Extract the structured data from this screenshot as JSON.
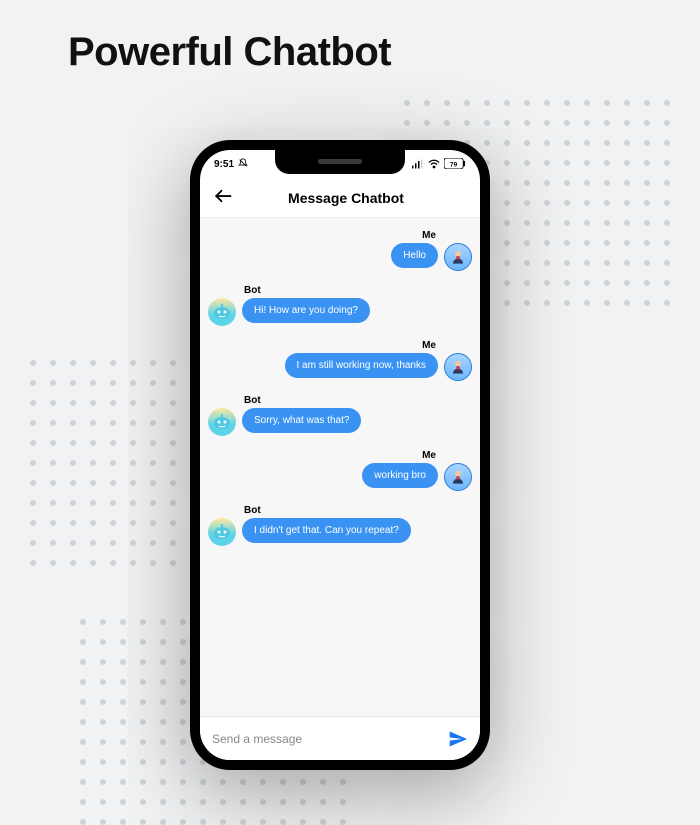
{
  "page": {
    "title": "Powerful Chatbot"
  },
  "status": {
    "time": "9:51",
    "battery": "79"
  },
  "header": {
    "title": "Message Chatbot"
  },
  "labels": {
    "me": "Me",
    "bot": "Bot"
  },
  "messages": [
    {
      "from": "me",
      "text": "Hello"
    },
    {
      "from": "bot",
      "text": "Hi! How are you doing?"
    },
    {
      "from": "me",
      "text": "I am still working now, thanks"
    },
    {
      "from": "bot",
      "text": "Sorry, what was that?"
    },
    {
      "from": "me",
      "text": "working bro"
    },
    {
      "from": "bot",
      "text": "I didn't get that. Can you repeat?"
    }
  ],
  "input": {
    "placeholder": "Send a message"
  },
  "colors": {
    "bubble": "#3a93f3",
    "send": "#1976f2"
  }
}
